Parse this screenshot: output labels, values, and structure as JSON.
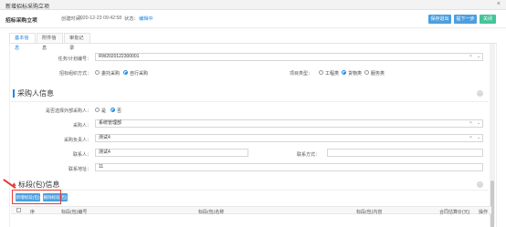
{
  "window": {
    "title": "新增招标采购立项",
    "close_glyph": "×"
  },
  "header": {
    "project_name": "招标采购立项",
    "creator_label": "创建时间：",
    "created_time": "2020-12-23 09:42:58",
    "status_label": "状态：",
    "status_value": "编辑中",
    "buttons": {
      "save": "保存退出",
      "next": "提下一步",
      "close": "关闭"
    }
  },
  "tabs": [
    "基本信息",
    "附件信息",
    "审批记录"
  ],
  "basic": {
    "agency_no_label": "任务/计划编号：",
    "agency_no_value": "RW2020122300001",
    "bid_method_label": "招标组织方式：",
    "bid_method_options": [
      "委托采购",
      "自行采购"
    ],
    "project_type_label": "项目类型：",
    "project_type_options": [
      "工程类",
      "货物类",
      "服务类"
    ]
  },
  "purchaser_section": {
    "title": "采购人信息",
    "is_entrust_label": "是否选择外部采购人：",
    "is_entrust_options": [
      "是",
      "否"
    ],
    "purchaser_label": "采购人：",
    "purchaser_value": "系统管理部",
    "purchase_org_label": "采购负责人：",
    "purchase_org_value": "测试4",
    "contact_label": "联系人：",
    "contact_value": "测试4",
    "contact_phone_label": "联系方式：",
    "contact_phone_value": "",
    "address_label": "联系地址：",
    "address_value": "11"
  },
  "lots_section": {
    "title": "标段(包)信息",
    "add_button": "新增标段(包)",
    "delete_button": "删除标段(包)",
    "columns": [
      "序",
      "标段(包)编号",
      "标段(包)名称",
      "标段(包)内容",
      "合同估算价(元)",
      "操作"
    ]
  },
  "colors": {
    "accent": "#1e88e5",
    "blue_button": "#4c9fe0",
    "green_button": "#46c39a",
    "annotation_red": "#e53935"
  },
  "icons": {
    "collapse": "minus-circle-icon",
    "chevron": "chevron-down-icon",
    "clear": "clear-icon"
  }
}
